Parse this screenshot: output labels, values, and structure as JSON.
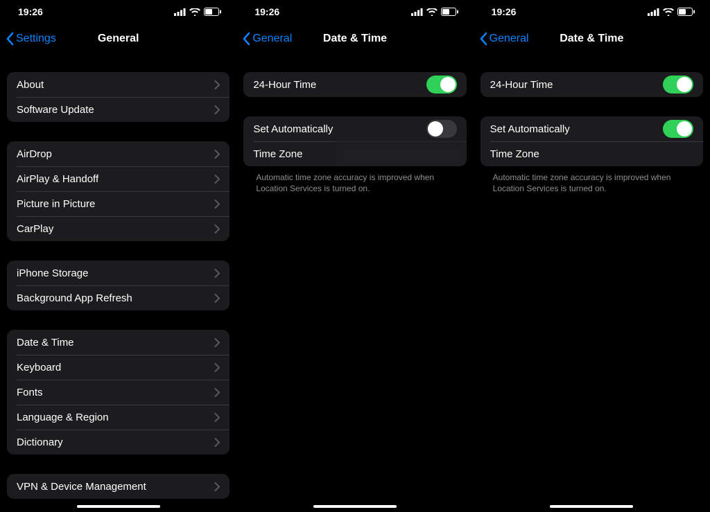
{
  "status": {
    "time": "19:26"
  },
  "screen1": {
    "back": "Settings",
    "title": "General",
    "groups": [
      [
        "About",
        "Software Update"
      ],
      [
        "AirDrop",
        "AirPlay & Handoff",
        "Picture in Picture",
        "CarPlay"
      ],
      [
        "iPhone Storage",
        "Background App Refresh"
      ],
      [
        "Date & Time",
        "Keyboard",
        "Fonts",
        "Language & Region",
        "Dictionary"
      ],
      [
        "VPN & Device Management"
      ]
    ]
  },
  "screen2": {
    "back": "General",
    "title": "Date & Time",
    "row_24h": "24-Hour Time",
    "row_auto": "Set Automatically",
    "row_tz": "Time Zone",
    "auto_on": false,
    "note": "Automatic time zone accuracy is improved when Location Services is turned on."
  },
  "screen3": {
    "back": "General",
    "title": "Date & Time",
    "row_24h": "24-Hour Time",
    "row_auto": "Set Automatically",
    "row_tz": "Time Zone",
    "auto_on": true,
    "note": "Automatic time zone accuracy is improved when Location Services is turned on."
  }
}
